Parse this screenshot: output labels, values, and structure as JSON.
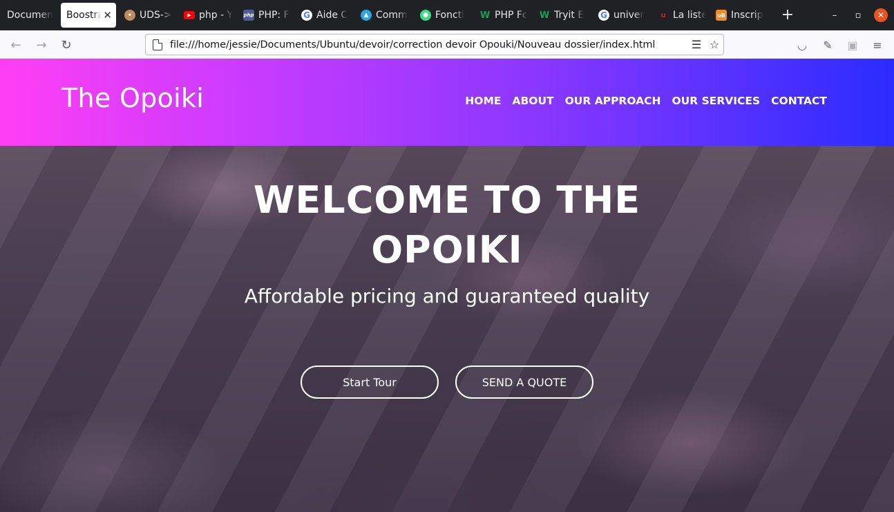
{
  "browser": {
    "tabs": [
      {
        "title": "Documen",
        "favicon": "none",
        "color": ""
      },
      {
        "title": "Boostra",
        "favicon": "none",
        "color": "",
        "active": true
      },
      {
        "title": "UDS->",
        "favicon": "person-icon",
        "color": "#c08a5a"
      },
      {
        "title": "php - Y",
        "favicon": "youtube-icon",
        "color": "#ff0000"
      },
      {
        "title": "PHP: F",
        "favicon": "php-icon",
        "color": "#4f5b93"
      },
      {
        "title": "Aide C",
        "favicon": "google-icon",
        "color": "#4285f4"
      },
      {
        "title": "Comm",
        "favicon": "linux-icon",
        "color": "#2aa7e0"
      },
      {
        "title": "Foncti",
        "favicon": "android-icon",
        "color": "#3ddc84"
      },
      {
        "title": "PHP Fc",
        "favicon": "w-icon",
        "color": "#18a058"
      },
      {
        "title": "Tryit E",
        "favicon": "w-icon",
        "color": "#18a058"
      },
      {
        "title": "univer",
        "favicon": "google-icon",
        "color": "#4285f4"
      },
      {
        "title": "La liste",
        "favicon": "u-icon",
        "color": "#c0272d"
      },
      {
        "title": "Inscrip",
        "favicon": "ub-icon",
        "color": "#f08a24"
      }
    ],
    "new_tab_glyph": "+",
    "window_controls": {
      "minimize": "–",
      "restore": "▫",
      "close": "✕"
    },
    "url": "file:///home/jessie/Documents/Ubuntu/devoir/correction devoir Opouki/Nouveau dossier/index.html"
  },
  "site": {
    "brand": "The Opoiki",
    "menu": [
      "HOME",
      "ABOUT",
      "OUR APPROACH",
      "OUR SERVICES",
      "CONTACT"
    ],
    "hero": {
      "title_line1": "WELCOME TO THE",
      "title_line2": "OPOIKI",
      "subtitle": "Affordable pricing and guaranteed quality",
      "primary_button": "Start Tour",
      "secondary_button": "SEND A QUOTE"
    }
  }
}
